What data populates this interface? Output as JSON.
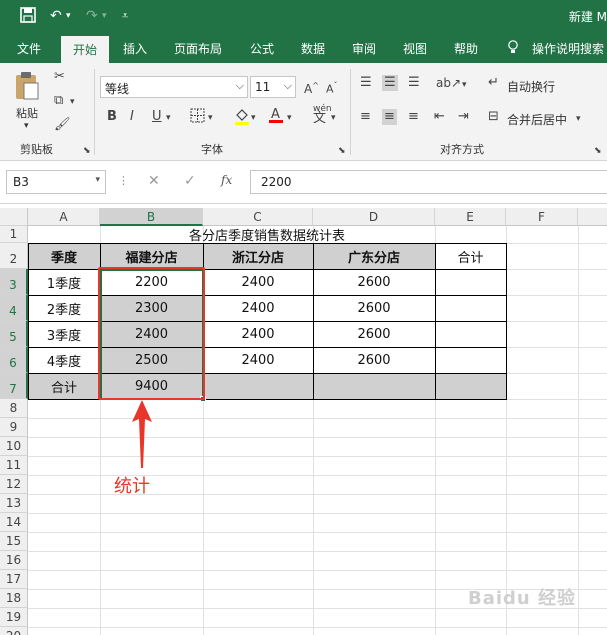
{
  "title_bar": {
    "window_title": "新建 M"
  },
  "tabs": [
    {
      "label": "文件"
    },
    {
      "label": "开始",
      "active": true
    },
    {
      "label": "插入"
    },
    {
      "label": "页面布局"
    },
    {
      "label": "公式"
    },
    {
      "label": "数据"
    },
    {
      "label": "审阅"
    },
    {
      "label": "视图"
    },
    {
      "label": "帮助"
    },
    {
      "label": "操作说明搜索"
    }
  ],
  "ribbon": {
    "clipboard": {
      "paste_label": "粘贴",
      "group_label": "剪贴板"
    },
    "font": {
      "font_name": "等线",
      "font_size": "11",
      "group_label": "字体",
      "bold": "B",
      "italic": "I",
      "underline": "U",
      "phonetic": "wén",
      "font_color": "#ff0000"
    },
    "alignment": {
      "wrap_text": "自动换行",
      "merge_center": "合并后居中",
      "group_label": "对齐方式"
    }
  },
  "formula_bar": {
    "name_box": "B3",
    "fx": "fx",
    "value": "2200"
  },
  "columns": [
    "A",
    "B",
    "C",
    "D",
    "E",
    "F"
  ],
  "rows": [
    "1",
    "2",
    "3",
    "4",
    "5",
    "6",
    "7",
    "8",
    "9",
    "10",
    "11",
    "12",
    "13",
    "14",
    "15",
    "16",
    "17",
    "18",
    "19",
    "20"
  ],
  "sheet": {
    "title": "各分店季度销售数据统计表",
    "headers": [
      "季度",
      "福建分店",
      "浙江分店",
      "广东分店",
      "合计"
    ],
    "data": [
      [
        "1季度",
        "2200",
        "2400",
        "2600",
        ""
      ],
      [
        "2季度",
        "2300",
        "2400",
        "2600",
        ""
      ],
      [
        "3季度",
        "2400",
        "2400",
        "2600",
        ""
      ],
      [
        "4季度",
        "2500",
        "2400",
        "2600",
        ""
      ],
      [
        "合计",
        "9400",
        "",
        "",
        ""
      ]
    ]
  },
  "annotation": {
    "label": "统计",
    "color": "#e8372a"
  },
  "watermark": "Baidu 经验"
}
